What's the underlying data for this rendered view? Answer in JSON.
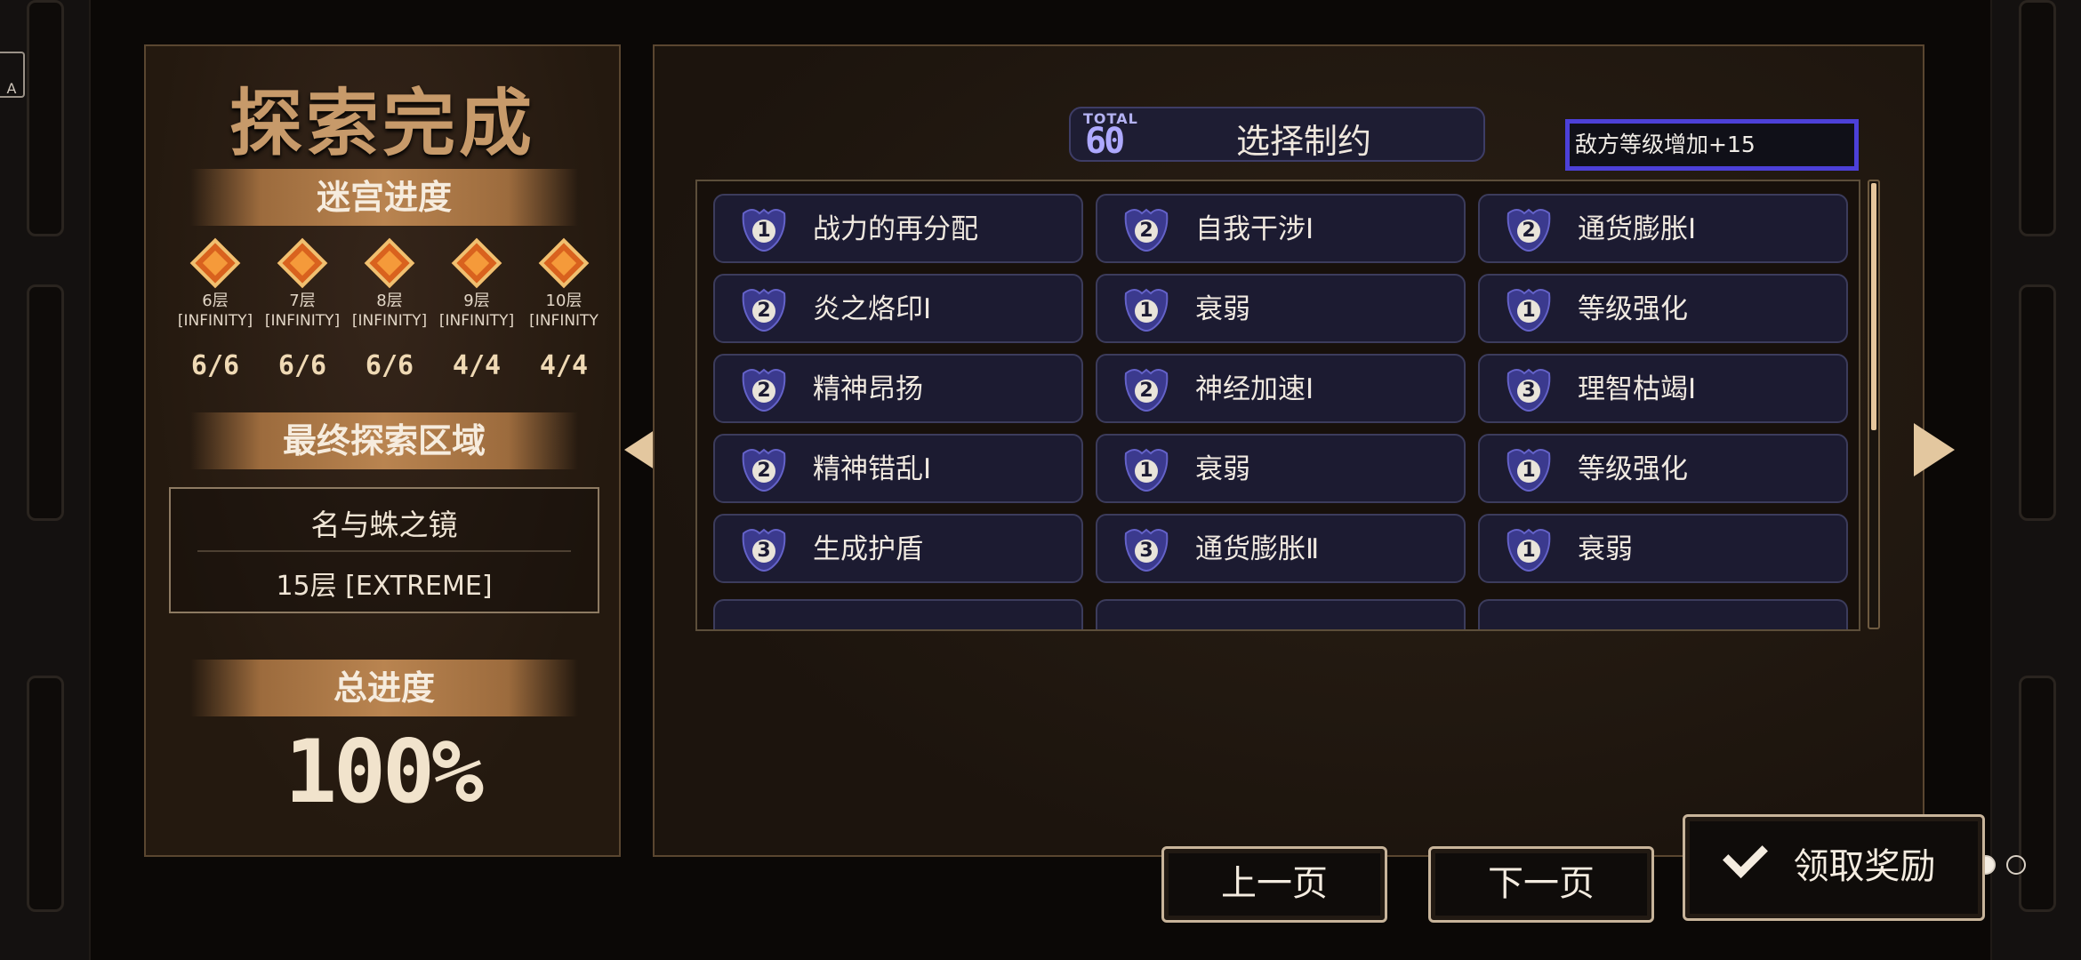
{
  "left_panel": {
    "title": "探索完成",
    "maze_progress_header": "迷宫进度",
    "floors": [
      {
        "name": "6层",
        "mode": "[INFINITY]",
        "progress": "6/6"
      },
      {
        "name": "7层",
        "mode": "[INFINITY]",
        "progress": "6/6"
      },
      {
        "name": "8层",
        "mode": "[INFINITY]",
        "progress": "6/6"
      },
      {
        "name": "9层",
        "mode": "[INFINITY]",
        "progress": "4/4"
      },
      {
        "name": "10层",
        "mode": "[INFINITY",
        "progress": "4/4"
      }
    ],
    "final_area_header": "最终探索区域",
    "final_area": {
      "name": "名与蛛之镜",
      "floor": "15层 [EXTREME]"
    },
    "total_progress_header": "总进度",
    "total_progress": "100%"
  },
  "main_panel": {
    "total_label": "TOTAL",
    "total_value": "60",
    "title": "选择制约",
    "selected_effect": "敌方等级增加+15",
    "constraints": [
      {
        "level": "1",
        "label": "战力的再分配"
      },
      {
        "level": "2",
        "label": "自我干涉Ⅰ"
      },
      {
        "level": "2",
        "label": "通货膨胀Ⅰ"
      },
      {
        "level": "2",
        "label": "炎之烙印Ⅰ"
      },
      {
        "level": "1",
        "label": "衰弱"
      },
      {
        "level": "1",
        "label": "等级强化"
      },
      {
        "level": "2",
        "label": "精神昂扬"
      },
      {
        "level": "2",
        "label": "神经加速Ⅰ"
      },
      {
        "level": "3",
        "label": "理智枯竭Ⅰ"
      },
      {
        "level": "2",
        "label": "精神错乱Ⅰ"
      },
      {
        "level": "1",
        "label": "衰弱"
      },
      {
        "level": "1",
        "label": "等级强化"
      },
      {
        "level": "3",
        "label": "生成护盾"
      },
      {
        "level": "3",
        "label": "通货膨胀Ⅱ"
      },
      {
        "level": "1",
        "label": "衰弱"
      }
    ],
    "page_indicator": {
      "total": 6,
      "current": 5
    },
    "scroll_position": 0.0
  },
  "buttons": {
    "prev": "上一页",
    "next": "下一页",
    "claim": "领取奖励"
  },
  "colors": {
    "accent_gold": "#c79a6a",
    "card_bg": "#1c1b31",
    "selected_border": "#4c40d8",
    "badge_purple": "#4d4ab8"
  },
  "icons": {
    "badge": "constraint-level-badge-icon",
    "diamond": "floor-diamond-icon",
    "check": "check-icon",
    "arrow_left": "arrow-left-icon",
    "arrow_right": "arrow-right-icon",
    "translate": "translate-icon"
  }
}
